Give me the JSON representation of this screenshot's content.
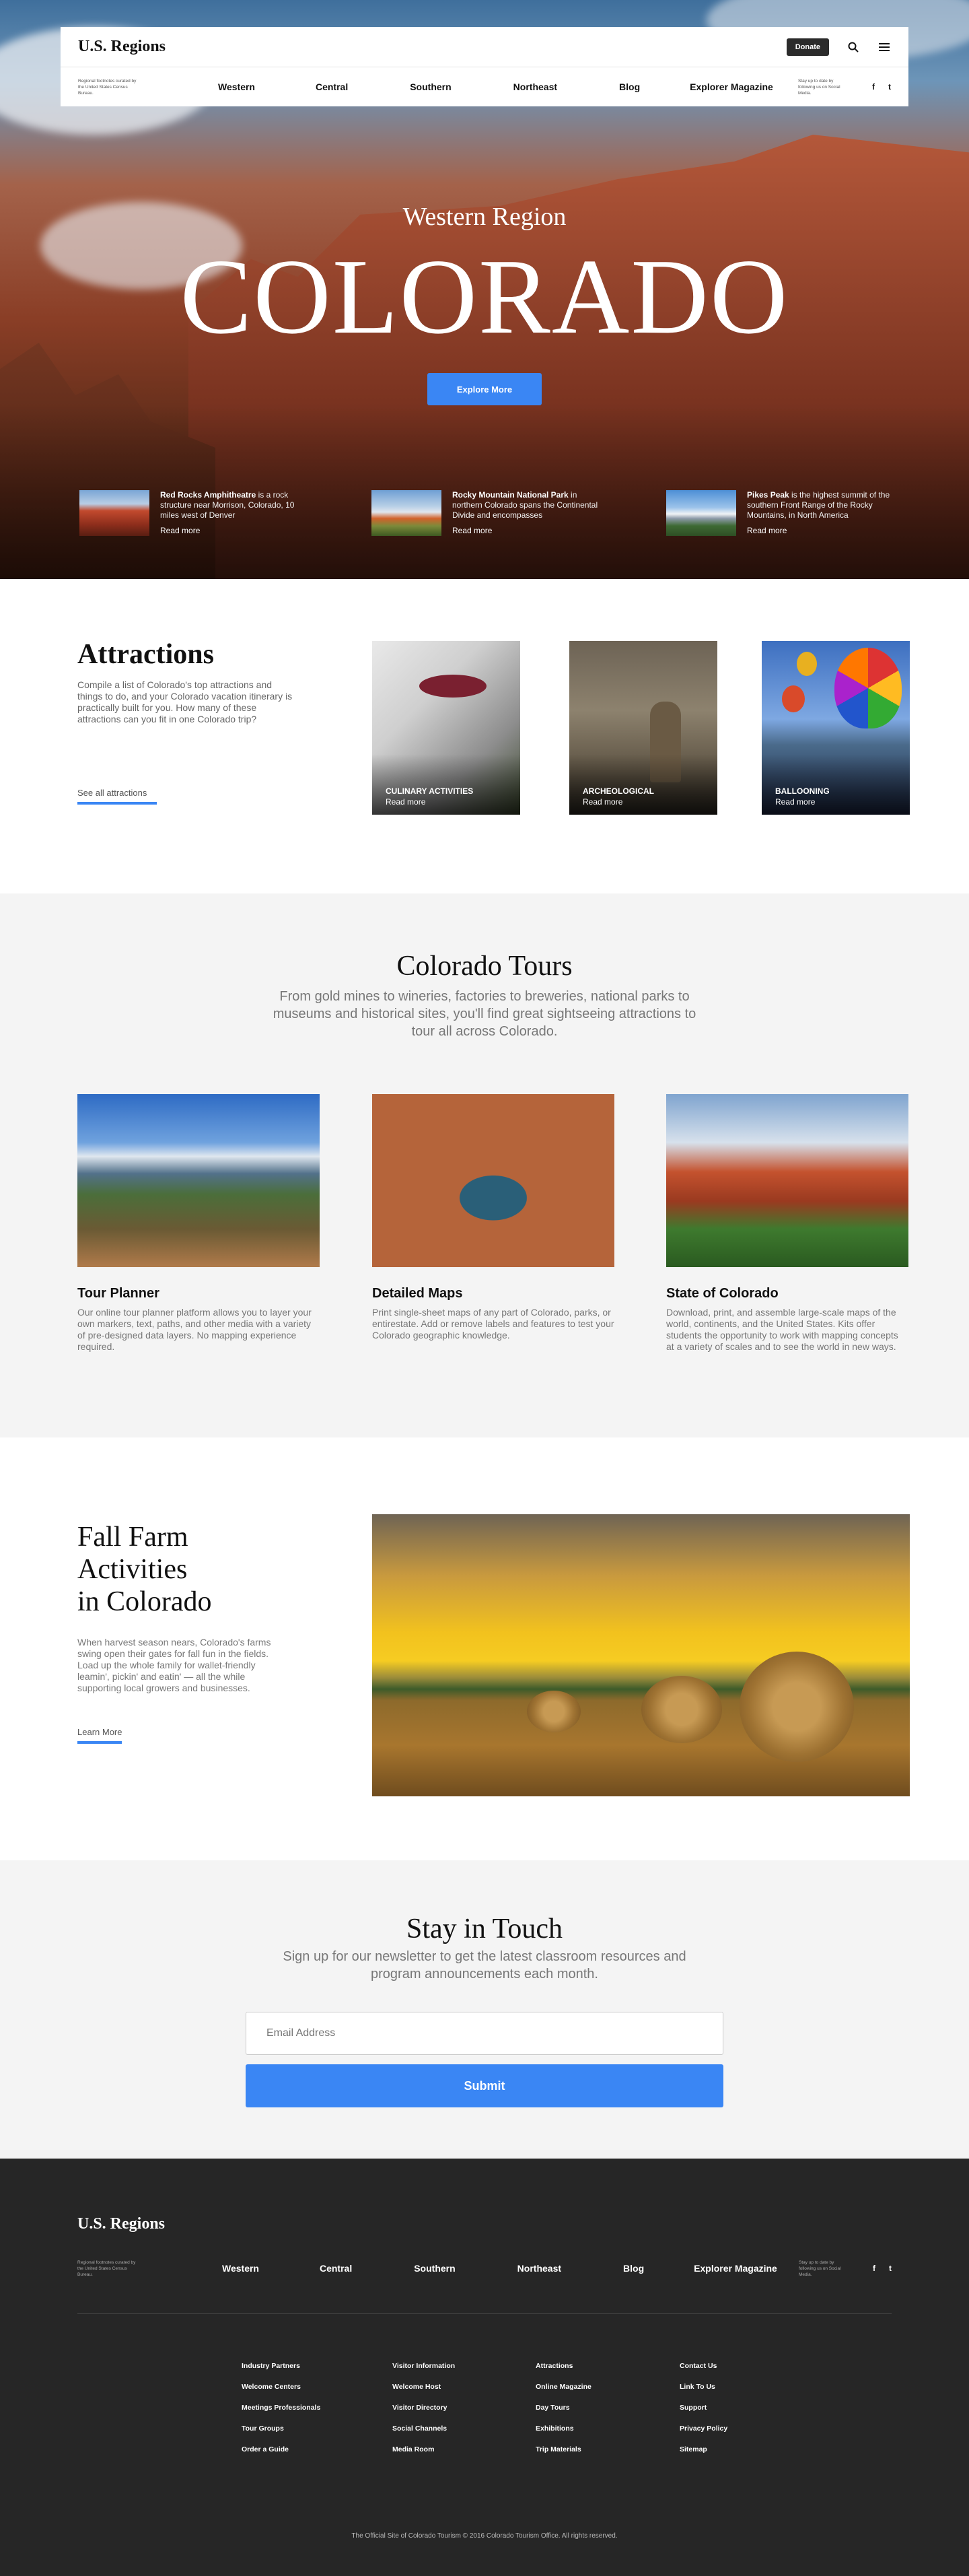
{
  "site": {
    "brand": "U.S. Regions",
    "tagline": "Regional footnotes curated by the United States Census Bureau.",
    "social_note": "Stay up to date by following us on Social Media."
  },
  "header": {
    "donate_label": "Donate"
  },
  "nav": [
    "Western",
    "Central",
    "Southern",
    "Northeast",
    "Blog",
    "Explorer Magazine"
  ],
  "social": [
    "f",
    "t"
  ],
  "hero": {
    "subtitle": "Western Region",
    "title": "COLORADO",
    "cta": "Explore More",
    "cards": [
      {
        "title": "Red Rocks Amphitheatre",
        "text": " is a rock structure near Morrison, Colorado, 10 miles west of Denver",
        "more": "Read more"
      },
      {
        "title": "Rocky Mountain National Park",
        "text": " in northern Colorado spans the Continental Divide and encompasses",
        "more": "Read more"
      },
      {
        "title": "Pikes Peak",
        "text": " is the highest summit of the southern Front Range of the Rocky Mountains, in North America",
        "more": "Read more"
      }
    ]
  },
  "attractions": {
    "title": "Attractions",
    "text": "Compile a list of Colorado's top attractions and things to do, and your Colorado vacation itinerary is practically built for you. How many of these attractions can you fit in one Colorado trip?",
    "link": "See all attractions",
    "tiles": [
      {
        "caption": "CULINARY ACTIVITIES",
        "more": "Read more"
      },
      {
        "caption": "ARCHEOLOGICAL",
        "more": "Read more"
      },
      {
        "caption": "BALLOONING",
        "more": "Read more"
      }
    ]
  },
  "tours": {
    "title": "Colorado Tours",
    "lead": "From gold mines to wineries, factories to breweries, national parks to museums and historical sites, you'll find great sightseeing attractions to tour all across Colorado.",
    "items": [
      {
        "title": "Tour Planner",
        "text": "Our online tour planner platform allows you to layer your own markers, text, paths, and other media with a variety of pre-designed data layers. No mapping experience required."
      },
      {
        "title": "Detailed Maps",
        "text": "Print single-sheet maps of any part of Colorado, parks, or entirestate. Add or remove labels and features to test your Colorado geographic knowledge."
      },
      {
        "title": "State of Colorado",
        "text": "Download, print, and assemble large-scale maps of the world, continents, and the United States. Kits offer students the opportunity to work with mapping concepts at a variety of scales and to see the world in new ways."
      }
    ]
  },
  "fall": {
    "title_lines": [
      "Fall Farm",
      "Activities",
      "in Colorado"
    ],
    "text": "When harvest season nears, Colorado's farms swing open their gates for fall fun in the fields. Load up the whole family for wallet-friendly leamin', pickin' and eatin' — all the while supporting local growers and businesses.",
    "link": "Learn More"
  },
  "newsletter": {
    "title": "Stay in Touch",
    "lead": "Sign up for our newsletter to get the latest classroom resources and program announcements each month.",
    "placeholder": "Email Address",
    "submit": "Submit"
  },
  "footer": {
    "columns": [
      [
        "Industry Partners",
        "Welcome Centers",
        "Meetings Professionals",
        "Tour Groups",
        "Order a Guide"
      ],
      [
        "Visitor Information",
        "Welcome Host",
        "Visitor Directory",
        "Social Channels",
        "Media Room"
      ],
      [
        "Attractions",
        "Online Magazine",
        "Day Tours",
        "Exhibitions",
        "Trip Materials"
      ],
      [
        "Contact Us",
        "Link To Us",
        "Support",
        "Privacy Policy",
        "Sitemap"
      ]
    ],
    "copyright": "The Official Site of Colorado Tourism © 2016 Colorado Tourism Office. All rights reserved."
  }
}
